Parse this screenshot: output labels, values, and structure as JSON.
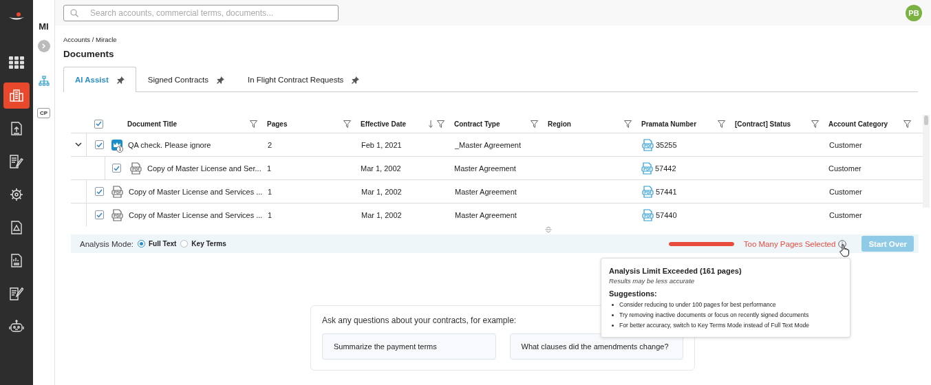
{
  "search": {
    "placeholder": "Search accounts, commercial terms, documents..."
  },
  "user": {
    "initials": "PB"
  },
  "sidebar": {
    "items": [
      {
        "selected": false
      },
      {
        "selected": true
      },
      {
        "selected": false
      },
      {
        "selected": false
      },
      {
        "selected": false
      },
      {
        "selected": false
      },
      {
        "selected": false
      },
      {
        "selected": false
      },
      {
        "selected": false
      }
    ]
  },
  "subnav": {
    "label": "MI",
    "badge": "CP"
  },
  "breadcrumb": "Accounts / Miracle",
  "title": "Documents",
  "tabs": [
    {
      "label": "AI Assist",
      "selected": true
    },
    {
      "label": "Signed Contracts",
      "selected": false
    },
    {
      "label": "In Flight Contract Requests",
      "selected": false
    }
  ],
  "table": {
    "select_all": {
      "checked": true
    },
    "columns": [
      {
        "label": "Document Title"
      },
      {
        "label": "Pages"
      },
      {
        "label": "Effective Date",
        "sorted_descending": true
      },
      {
        "label": "Contract Type"
      },
      {
        "label": "Region"
      },
      {
        "label": "Pramata Number"
      },
      {
        "label": "[Contract] Status"
      },
      {
        "label": "Account Category"
      }
    ],
    "rows": [
      {
        "kind": "bundle",
        "badge": "1",
        "checked": true,
        "expanded": true,
        "title": "QA check. Please ignore",
        "pages": "2",
        "effective_date": "Feb 1, 2021",
        "contract_type": "_Master Agreement",
        "pramata_number": "35255",
        "account_category": "Customer",
        "children": [
          {
            "kind": "pdf",
            "checked": true,
            "title": "Copy of Master License and Ser...",
            "pages": "1",
            "effective_date": "Mar 1, 2002",
            "contract_type": "Master Agreement",
            "pramata_number": "57442",
            "account_category": "Customer"
          }
        ]
      },
      {
        "kind": "pdf",
        "checked": true,
        "title": "Copy of Master License and Services ...",
        "pages": "1",
        "effective_date": "Mar 1, 2002",
        "contract_type": "Master Agreement",
        "pramata_number": "57441",
        "account_category": "Customer"
      },
      {
        "kind": "pdf",
        "checked": true,
        "title": "Copy of Master License and Services ...",
        "pages": "1",
        "effective_date": "Mar 1, 2002",
        "contract_type": "Master Agreement",
        "pramata_number": "57440",
        "account_category": "Customer"
      }
    ]
  },
  "analysis": {
    "label": "Analysis Mode:",
    "options": [
      {
        "label": "Full Text",
        "selected": true
      },
      {
        "label": "Key Terms",
        "selected": false
      }
    ],
    "level": 1,
    "warning": "Too Many Pages Selected",
    "button": {
      "label": "Start Over",
      "disabled": true
    }
  },
  "tooltip": {
    "title": "Analysis Limit Exceeded (161 pages)",
    "subtitle": "Results may be less accurate",
    "heading": "Suggestions:",
    "items": [
      "Consider reducing to under 100 pages for best performance",
      "Try removing inactive documents or focus on recently signed documents",
      "For better accuracy, switch to Key Terms Mode instead of Full Text Mode"
    ]
  },
  "prompt": {
    "text": "Ask any questions about your contracts, for example:",
    "suggestions": [
      "Summarize the payment terms",
      "What clauses did the amendments change?"
    ]
  }
}
